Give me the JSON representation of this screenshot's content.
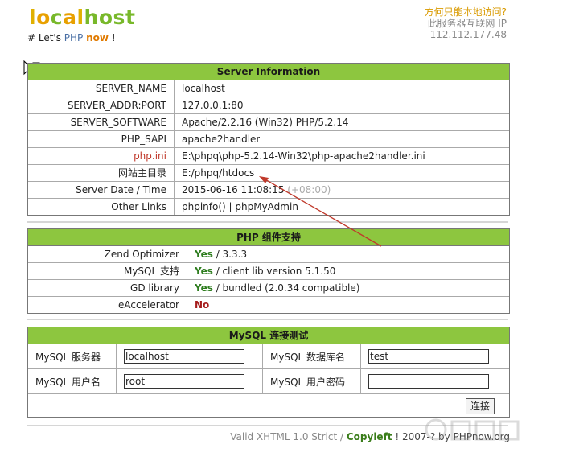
{
  "header": {
    "logo_letters": [
      "l",
      "o",
      "c",
      "a",
      "l",
      "h",
      "o",
      "s",
      "t"
    ],
    "logo_colors": [
      "#e0b000",
      "#e8a000",
      "#78b82a",
      "#e8a000",
      "#e0b000",
      "#78b82a",
      "#78b82a",
      "#78b82a",
      "#78b82a"
    ],
    "tagline_prefix": "# Let's ",
    "tagline_php": "PHP",
    "tagline_now": "now",
    "tagline_suffix": " !",
    "question_link": "方何只能本地访问?",
    "ip_label": "此服务器互联网 IP",
    "ip_value": "112.112.177.48"
  },
  "server_info": {
    "title": "Server Information",
    "rows": [
      {
        "label": "SERVER_NAME",
        "value": "localhost"
      },
      {
        "label": "SERVER_ADDR:PORT",
        "value": "127.0.0.1:80"
      },
      {
        "label": "SERVER_SOFTWARE",
        "value": "Apache/2.2.16 (Win32) PHP/5.2.14"
      },
      {
        "label": "PHP_SAPI",
        "value": "apache2handler"
      },
      {
        "label": "php.ini",
        "value": "E:\\phpq\\php-5.2.14-Win32\\php-apache2handler.ini"
      },
      {
        "label": "网站主目录",
        "value": "E:/phpq/htdocs"
      },
      {
        "label": "Server Date / Time",
        "value": "2015-06-16 11:08:15",
        "extra": "(+08:00)"
      },
      {
        "label": "Other Links",
        "value": "phpinfo() | phpMyAdmin"
      }
    ]
  },
  "php_components": {
    "title": "PHP 组件支持",
    "rows": [
      {
        "label": "Zend Optimizer",
        "status": "Yes",
        "detail": " / 3.3.3"
      },
      {
        "label": "MySQL 支持",
        "status": "Yes",
        "detail": " / client lib version 5.1.50"
      },
      {
        "label": "GD library",
        "status": "Yes",
        "detail": " / bundled (2.0.34 compatible)"
      },
      {
        "label": "eAccelerator",
        "status": "No",
        "detail": ""
      }
    ]
  },
  "mysql_test": {
    "title": "MySQL 连接测试",
    "server_label": "MySQL 服务器",
    "server_value": "localhost",
    "dbname_label": "MySQL 数据库名",
    "dbname_value": "test",
    "user_label": "MySQL 用户名",
    "user_value": "root",
    "password_label": "MySQL 用户密码",
    "password_value": "",
    "connect_label": "连接"
  },
  "footer": {
    "valid": "Valid XHTML 1.0 Strict",
    "sep": " / ",
    "copyleft": "Copyleft",
    "rest": " ! 2007-? by PHPnow.org"
  },
  "colors": {
    "panel_header": "#8dc63f",
    "yes": "#2e7d1f",
    "no": "#a51c1c",
    "arrow": "#c0392b"
  }
}
